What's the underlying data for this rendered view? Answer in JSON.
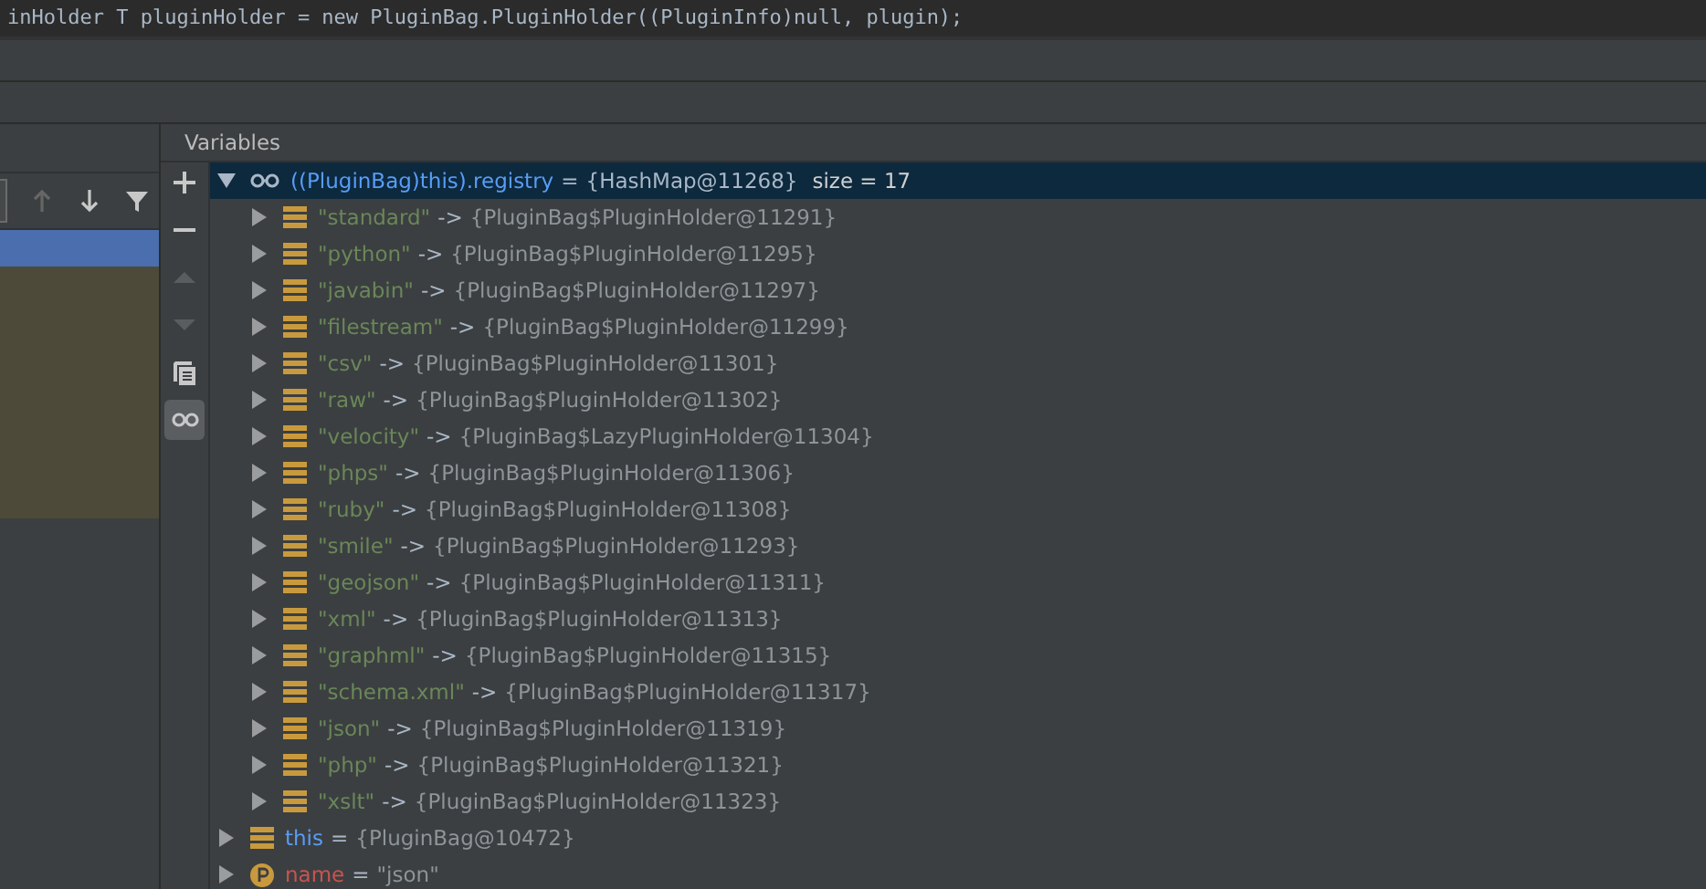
{
  "editor": {
    "code_line": "inHolder T pluginHolder = new PluginBag.PluginHolder((PluginInfo)null, plugin);"
  },
  "frames_panel": {
    "toolbar": [
      {
        "kind": "up",
        "disabled": true
      },
      {
        "kind": "down",
        "disabled": false
      },
      {
        "kind": "filter",
        "disabled": false
      }
    ],
    "rows": [
      {
        "selected": true
      }
    ]
  },
  "variables": {
    "title": "Variables",
    "side_toolbar": [
      {
        "kind": "add",
        "disabled": false,
        "selected": false
      },
      {
        "kind": "remove",
        "disabled": false,
        "selected": false
      },
      {
        "kind": "up",
        "disabled": true,
        "selected": false
      },
      {
        "kind": "down",
        "disabled": true,
        "selected": false
      },
      {
        "kind": "copy",
        "disabled": false,
        "selected": false
      },
      {
        "kind": "watches",
        "disabled": false,
        "selected": true
      }
    ],
    "tree": [
      {
        "kind": "watch",
        "name": "((PluginBag)this).registry",
        "op": "=",
        "value": "{HashMap@11268}",
        "extra": "size = 17",
        "expanded": true,
        "selected": true,
        "children": [
          {
            "kind": "entry",
            "key": "\"standard\"",
            "op": "->",
            "value": "{PluginBag$PluginHolder@11291}",
            "expanded": false,
            "selected": false
          },
          {
            "kind": "entry",
            "key": "\"python\"",
            "op": "->",
            "value": "{PluginBag$PluginHolder@11295}",
            "expanded": false,
            "selected": false
          },
          {
            "kind": "entry",
            "key": "\"javabin\"",
            "op": "->",
            "value": "{PluginBag$PluginHolder@11297}",
            "expanded": false,
            "selected": false
          },
          {
            "kind": "entry",
            "key": "\"filestream\"",
            "op": "->",
            "value": "{PluginBag$PluginHolder@11299}",
            "expanded": false,
            "selected": false
          },
          {
            "kind": "entry",
            "key": "\"csv\"",
            "op": "->",
            "value": "{PluginBag$PluginHolder@11301}",
            "expanded": false,
            "selected": false
          },
          {
            "kind": "entry",
            "key": "\"raw\"",
            "op": "->",
            "value": "{PluginBag$PluginHolder@11302}",
            "expanded": false,
            "selected": false
          },
          {
            "kind": "entry",
            "key": "\"velocity\"",
            "op": "->",
            "value": "{PluginBag$LazyPluginHolder@11304}",
            "expanded": false,
            "selected": false
          },
          {
            "kind": "entry",
            "key": "\"phps\"",
            "op": "->",
            "value": "{PluginBag$PluginHolder@11306}",
            "expanded": false,
            "selected": false
          },
          {
            "kind": "entry",
            "key": "\"ruby\"",
            "op": "->",
            "value": "{PluginBag$PluginHolder@11308}",
            "expanded": false,
            "selected": false
          },
          {
            "kind": "entry",
            "key": "\"smile\"",
            "op": "->",
            "value": "{PluginBag$PluginHolder@11293}",
            "expanded": false,
            "selected": false
          },
          {
            "kind": "entry",
            "key": "\"geojson\"",
            "op": "->",
            "value": "{PluginBag$PluginHolder@11311}",
            "expanded": false,
            "selected": false
          },
          {
            "kind": "entry",
            "key": "\"xml\"",
            "op": "->",
            "value": "{PluginBag$PluginHolder@11313}",
            "expanded": false,
            "selected": false
          },
          {
            "kind": "entry",
            "key": "\"graphml\"",
            "op": "->",
            "value": "{PluginBag$PluginHolder@11315}",
            "expanded": false,
            "selected": false
          },
          {
            "kind": "entry",
            "key": "\"schema.xml\"",
            "op": "->",
            "value": "{PluginBag$PluginHolder@11317}",
            "expanded": false,
            "selected": false
          },
          {
            "kind": "entry",
            "key": "\"json\"",
            "op": "->",
            "value": "{PluginBag$PluginHolder@11319}",
            "expanded": false,
            "selected": false
          },
          {
            "kind": "entry",
            "key": "\"php\"",
            "op": "->",
            "value": "{PluginBag$PluginHolder@11321}",
            "expanded": false,
            "selected": false
          },
          {
            "kind": "entry",
            "key": "\"xslt\"",
            "op": "->",
            "value": "{PluginBag$PluginHolder@11323}",
            "expanded": false,
            "selected": false
          }
        ]
      },
      {
        "kind": "field",
        "name": "this",
        "op": "=",
        "value": "{PluginBag@10472}",
        "expanded": false,
        "selected": false
      },
      {
        "kind": "param",
        "name": "name",
        "op": "=",
        "value": "\"json\"",
        "expanded": false,
        "selected": false
      }
    ]
  }
}
